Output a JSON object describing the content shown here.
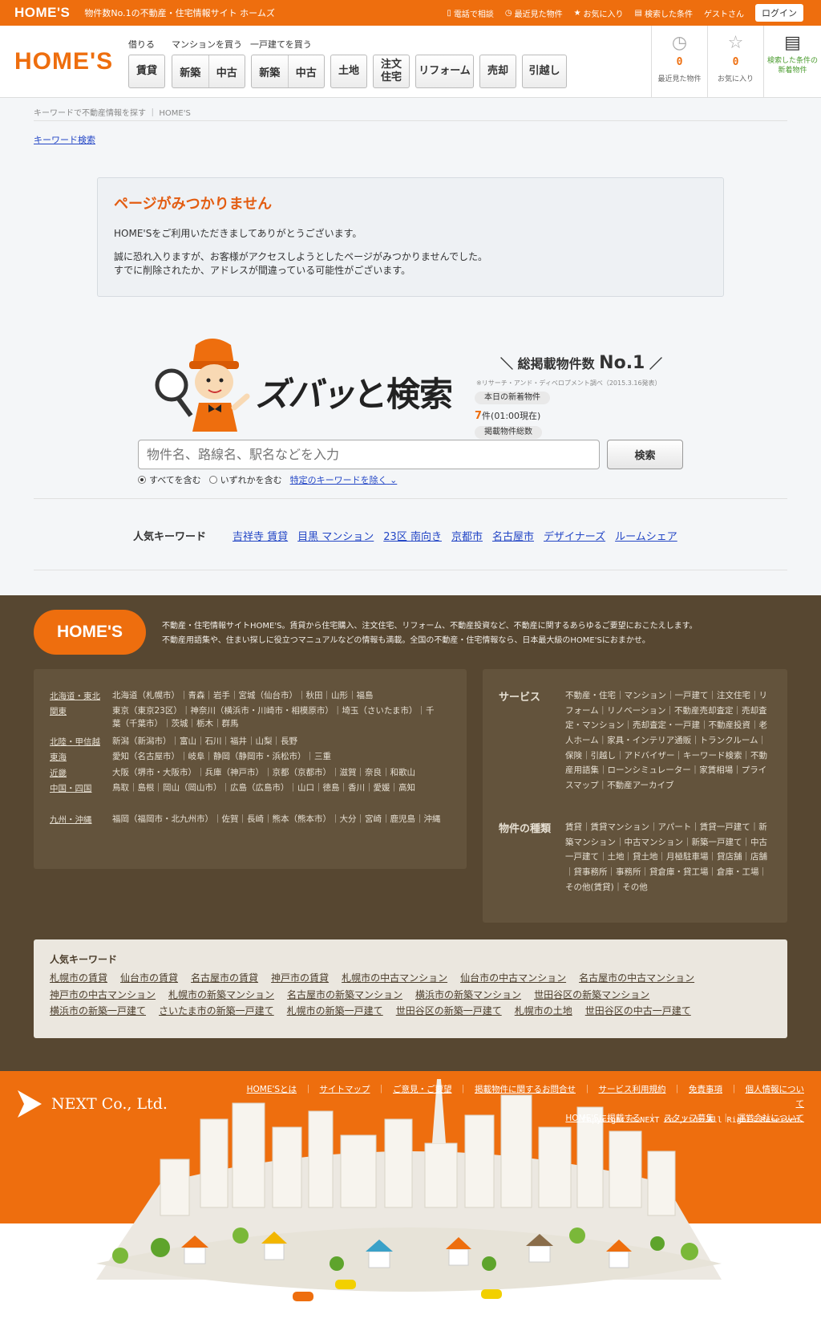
{
  "topbar": {
    "brand": "HOME'S",
    "tagline": "物件数No.1の不動産・住宅情報サイト ホームズ",
    "links": [
      "電話で相談",
      "最近見た物件",
      "お気に入り",
      "検索した条件"
    ],
    "guest": "ゲストさん",
    "login": "ログイン"
  },
  "header": {
    "logo": "HOME'S",
    "groups": {
      "rent": "借りる",
      "mansion": "マンションを買う",
      "house": "一戸建てを買う"
    },
    "nav": {
      "chintai": "賃貸",
      "m_new": "新築",
      "m_used": "中古",
      "h_new": "新築",
      "h_used": "中古",
      "land": "土地",
      "custom": "注文住宅",
      "reform": "リフォーム",
      "sell": "売却",
      "move": "引越し"
    },
    "recent": {
      "count": "0",
      "label": "最近見た物件",
      "icon": "clock-icon"
    },
    "favorite": {
      "count": "0",
      "label": "お気に入り",
      "icon": "star-icon"
    },
    "saved": {
      "label": "検索した条件の新着物件",
      "icon": "note-icon"
    }
  },
  "breadcrumb": "キーワードで不動産情報を探す ｜ HOME'S",
  "keyword_search_link": "キーワード検索",
  "error": {
    "title": "ページがみつかりません",
    "p1": "HOME'Sをご利用いただきましてありがとうございます。",
    "p2a": "誠に恐れ入りますが、お客様がアクセスしようとしたページがみつかりませんでした。",
    "p2b": "すでに削除されたか、アドレスが間違っている可能性がございます。"
  },
  "hero": {
    "title_a": "ズバッ",
    "title_b": "と検索",
    "no1_text": "総掲載物件数",
    "no1_badge": "No.1",
    "no1_note": "※リサーチ・アンド・ディベロプメント調べ（2015.3.16発表）",
    "today_label": "本日の新着物件",
    "today_count": "7",
    "today_suffix": "件(01:00現在)",
    "total_label": "掲載物件総数"
  },
  "search": {
    "placeholder": "物件名、路線名、駅名などを入力",
    "button": "検索",
    "opt_all": "すべてを含む",
    "opt_any": "いずれかを含む",
    "exclude": "特定のキーワードを除く"
  },
  "popular": {
    "label": "人気キーワード",
    "links": [
      "吉祥寺 賃貸",
      "目黒 マンション",
      "23区 南向き",
      "京都市",
      "名古屋市",
      "デザイナーズ",
      "ルームシェア"
    ]
  },
  "footer": {
    "logo": "HOME'S",
    "intro1": "不動産・住宅情報サイトHOME'S。賃貸から住宅購入、注文住宅、リフォーム、不動産投資など、不動産に関するあらゆるご要望におこたえします。",
    "intro2": "不動産用語集や、住まい探しに役立つマニュアルなどの情報も満載。全国の不動産・住宅情報なら、日本最大級のHOME'Sにおまかせ。",
    "areas": [
      {
        "region": "北海道・東北",
        "prefs": "北海道（札幌市）｜青森｜岩手｜宮城（仙台市）｜秋田｜山形｜福島"
      },
      {
        "region": "関東",
        "prefs": "東京（東京23区）｜神奈川（横浜市・川崎市・相模原市）｜埼玉（さいたま市）｜千葉（千葉市）｜茨城｜栃木｜群馬"
      },
      {
        "region": "北陸・甲信越",
        "prefs": "新潟（新潟市）｜富山｜石川｜福井｜山梨｜長野"
      },
      {
        "region": "東海",
        "prefs": "愛知（名古屋市）｜岐阜｜静岡（静岡市・浜松市）｜三重"
      },
      {
        "region": "近畿",
        "prefs": "大阪（堺市・大阪市）｜兵庫（神戸市）｜京都（京都市）｜滋賀｜奈良｜和歌山"
      },
      {
        "region": "中国・四国",
        "prefs": "鳥取｜島根｜岡山（岡山市）｜広島（広島市）｜山口｜徳島｜香川｜愛媛｜高知"
      },
      {
        "region": "九州・沖縄",
        "prefs": "福岡（福岡市・北九州市）｜佐賀｜長崎｜熊本（熊本市）｜大分｜宮崎｜鹿児島｜沖縄"
      }
    ],
    "service_title": "サービス",
    "services": "不動産・住宅｜マンション｜一戸建て｜注文住宅｜リフォーム｜リノベーション｜不動産売却査定｜売却査定・マンション｜売却査定・一戸建｜不動産投資｜老人ホーム｜家具・インテリア通販｜トランクルーム｜保険｜引越し｜アドバイザー｜キーワード検索｜不動産用語集｜ローンシミュレーター｜家賃相場｜プライスマップ｜不動産アーカイブ",
    "types_title": "物件の種類",
    "types": "賃貸｜賃貸マンション｜アパート｜賃貸一戸建て｜新築マンション｜中古マンション｜新築一戸建て｜中古一戸建て｜土地｜貸土地｜月極駐車場｜貸店舗｜店舗｜貸事務所｜事務所｜貸倉庫・貸工場｜倉庫・工場｜その他(賃貸)｜その他",
    "pop_title": "人気キーワード",
    "pop_links": [
      "札幌市の賃貸",
      "仙台市の賃貸",
      "名古屋市の賃貸",
      "神戸市の賃貸",
      "札幌市の中古マンション",
      "仙台市の中古マンション",
      "名古屋市の中古マンション",
      "神戸市の中古マンション",
      "札幌市の新築マンション",
      "名古屋市の新築マンション",
      "横浜市の新築マンション",
      "世田谷区の新築マンション",
      "横浜市の新築一戸建て",
      "さいたま市の新築一戸建て",
      "札幌市の新築一戸建て",
      "世田谷区の新築一戸建て",
      "札幌市の土地",
      "世田谷区の中古一戸建て"
    ]
  },
  "bottom": {
    "company": "NEXT Co., Ltd.",
    "links1": [
      "HOME'Sとは",
      "サイトマップ",
      "ご意見・ご要望",
      "掲載物件に関するお問合せ",
      "サービス利用規約",
      "免責事項",
      "個人情報について"
    ],
    "links2": [
      "HOME'Sに掲載する",
      "スタッフ募集",
      "運営会社について"
    ],
    "copyright": "Copyright © NEXT Co.,Ltd. All Rights Reserved."
  },
  "colors": {
    "brand": "#ee6e0e",
    "footer_dark": "#574731",
    "error_title": "#e35d12"
  }
}
